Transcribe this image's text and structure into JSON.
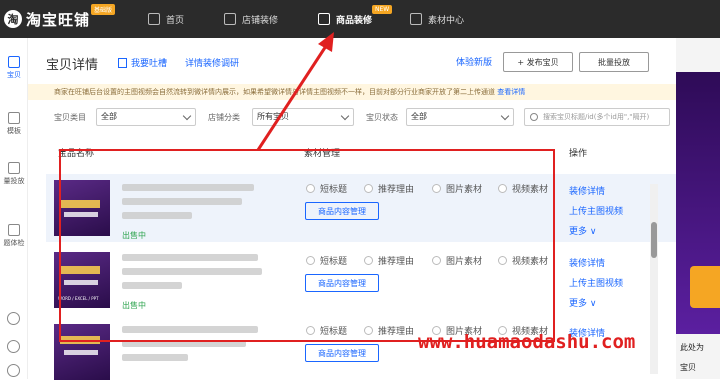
{
  "app": {
    "logo_text": "淘宝旺铺",
    "logo_badge": "基础版",
    "nav": [
      {
        "label": "首页",
        "active": false
      },
      {
        "label": "店铺装修",
        "active": false
      },
      {
        "label": "商品装修",
        "active": true,
        "badge": "NEW"
      },
      {
        "label": "素材中心",
        "active": false
      }
    ]
  },
  "rail": {
    "items": [
      {
        "label": "宝贝",
        "active": true
      },
      {
        "label": "模板",
        "active": false
      },
      {
        "label": "量投放",
        "active": false
      },
      {
        "label": "题体检",
        "active": false
      }
    ]
  },
  "page": {
    "title": "宝贝详情",
    "link_want": "我要吐槽",
    "link_tutorial": "详情装修调研",
    "link_new_version": "体验新版",
    "btn_publish": "+ 发布宝贝",
    "btn_batch": "批量投放",
    "notice_text": "商家在旺铺后台设置的主图视频会自然流转到微详情内展示，如果希望微详情与详情主图视频不一样，目前对部分行业商家开放了第二上传通道",
    "notice_link": "查看详情"
  },
  "filters": {
    "category_label": "宝贝类目",
    "category_value": "全部",
    "shop_label": "店铺分类",
    "shop_value": "所有宝贝",
    "status_label": "宝贝状态",
    "status_value": "全部",
    "search_placeholder": "搜索宝贝标题/id(多个id用\",\"隔开)"
  },
  "table": {
    "col_name": "宝品名称",
    "col_material": "素材管理",
    "col_op": "操作",
    "material_options": [
      "短标题",
      "推荐理由",
      "图片素材",
      "视频素材"
    ],
    "manage_label": "商品内容管理",
    "op_links": [
      "装修详情",
      "上传主图视频",
      "更多 ∨"
    ],
    "rows": [
      {
        "status": "出售中",
        "thumb_caption": ""
      },
      {
        "status": "出售中",
        "thumb_caption": "WORD / EXCEL / PPT"
      },
      {
        "status": "",
        "thumb_caption": ""
      }
    ]
  },
  "right": {
    "text_1": "此处为",
    "text_2": "宝贝"
  },
  "watermark": "www.huamaodashu.com",
  "colors": {
    "accent": "#1a66ff",
    "highlight": "#e02020",
    "topbar": "#2b2b2b"
  }
}
